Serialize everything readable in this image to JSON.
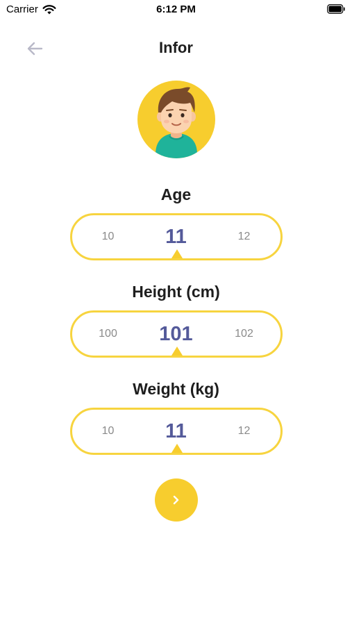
{
  "status_bar": {
    "carrier": "Carrier",
    "time": "6:12 PM"
  },
  "header": {
    "title": "Infor",
    "back_icon": "arrow-left-icon"
  },
  "avatar": {
    "icon": "boy-avatar-icon",
    "background_color": "#f7cd2e"
  },
  "pickers": [
    {
      "label": "Age",
      "prev": "10",
      "current": "11",
      "next": "12"
    },
    {
      "label": "Height (cm)",
      "prev": "100",
      "current": "101",
      "next": "102"
    },
    {
      "label": "Weight (kg)",
      "prev": "10",
      "current": "11",
      "next": "12"
    }
  ],
  "next_button": {
    "icon": "chevron-right-icon"
  },
  "colors": {
    "accent": "#f7cd2e",
    "selected_value": "#545a9a",
    "muted_value": "#8a8a8a",
    "title": "#1e1e1e"
  }
}
